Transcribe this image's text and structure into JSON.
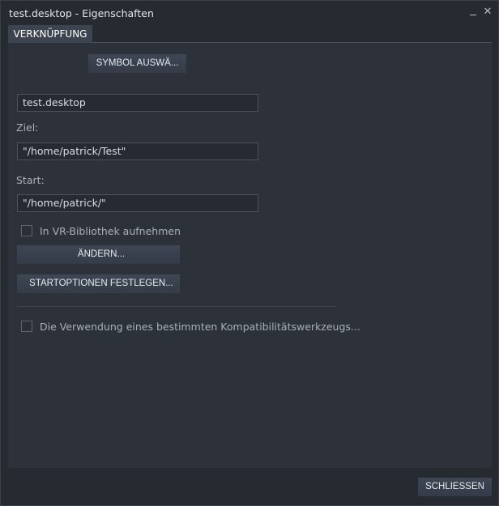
{
  "window": {
    "title": "test.desktop - Eigenschaften",
    "minimize_glyph": "",
    "close_glyph": "✕"
  },
  "tabs": [
    {
      "label": "VERKNÜPFUNG",
      "active": true
    }
  ],
  "shortcut": {
    "choose_icon_label": "SYMBOL AUSWÄ...",
    "name_value": "test.desktop",
    "target_label": "Ziel:",
    "target_value": "\"/home/patrick/Test\"",
    "start_label": "Start:",
    "start_value": "\"/home/patrick/\"",
    "vr_checkbox_label": "In VR-Bibliothek aufnehmen",
    "vr_checked": false,
    "change_button_label": "ÄNDERN...",
    "launch_options_label": "STARTOPTIONEN FESTLEGEN...",
    "compat_checkbox_label": "Die Verwendung eines bestimmten Kompatibilitätswerkzeugs...",
    "compat_checked": false
  },
  "footer": {
    "close_label": "SCHLIESSEN"
  }
}
